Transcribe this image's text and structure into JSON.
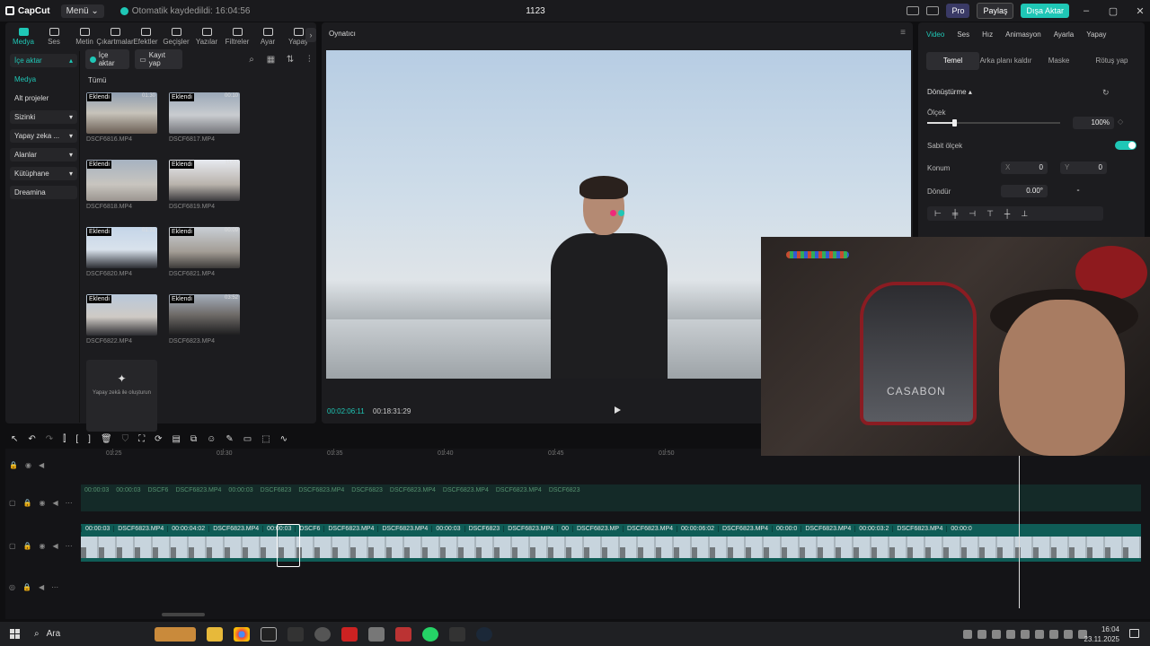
{
  "app": {
    "logo": "CapCut",
    "menu_label": "Menü",
    "autosave": "Otomatik kaydedildi: 16:04:56",
    "project_title": "1123",
    "pro_label": "Pro",
    "share_label": "Paylaş",
    "export_label": "Dışa Aktar"
  },
  "tabs": [
    {
      "label": "Medya"
    },
    {
      "label": "Ses"
    },
    {
      "label": "Metin"
    },
    {
      "label": "Çıkartmalar"
    },
    {
      "label": "Efektler"
    },
    {
      "label": "Geçişler"
    },
    {
      "label": "Yazılar"
    },
    {
      "label": "Filtreler"
    },
    {
      "label": "Ayar"
    },
    {
      "label": "Yapay"
    }
  ],
  "sidebar": [
    {
      "label": "İçe aktar"
    },
    {
      "label": "Medya"
    },
    {
      "label": "Alt projeler"
    },
    {
      "label": "Sizinki"
    },
    {
      "label": "Yapay zeka ..."
    },
    {
      "label": "Alanlar"
    },
    {
      "label": "Kütüphane"
    },
    {
      "label": "Dreamina"
    }
  ],
  "media": {
    "import_label": "İçe aktar",
    "record_label": "Kayıt yap",
    "all_label": "Tümü",
    "badge": "Eklendi",
    "files": [
      {
        "name": "DSCF6816.MP4",
        "duration": "01:30"
      },
      {
        "name": "DSCF6817.MP4",
        "duration": "00:10"
      },
      {
        "name": "DSCF6818.MP4",
        "duration": ""
      },
      {
        "name": "DSCF6819.MP4",
        "duration": "11:01"
      },
      {
        "name": "DSCF6820.MP4",
        "duration": "01:31"
      },
      {
        "name": "DSCF6821.MP4",
        "duration": "00:09"
      },
      {
        "name": "DSCF6822.MP4",
        "duration": ""
      },
      {
        "name": "DSCF6823.MP4",
        "duration": "03:52"
      }
    ],
    "ai_card": "Yapay zekâ ile oluşturun"
  },
  "player": {
    "title": "Oynatıcı",
    "current_time": "00:02:06:11",
    "total_time": "00:18:31:29"
  },
  "props": {
    "tabs": [
      "Video",
      "Ses",
      "Hız",
      "Animasyon",
      "Ayarla",
      "Yapay"
    ],
    "sub_tabs": [
      "Temel",
      "Arka planı kaldır",
      "Maske",
      "Rötuş yap"
    ],
    "section": "Dönüştürme",
    "scale_label": "Ölçek",
    "scale_value": "100%",
    "scale_level": 0.2,
    "uniform_label": "Sabit ölçek",
    "position_label": "Konum",
    "pos_x_label": "X",
    "pos_x": "0",
    "pos_y_label": "Y",
    "pos_y": "0",
    "rotate_label": "Döndür",
    "rotate_value": "0.00°"
  },
  "timeline": {
    "ruler": [
      "01:25",
      "01:30",
      "01:35",
      "01:40",
      "01:45",
      "01:50"
    ],
    "main_clips": [
      "00:00:03",
      "DSCF6823.MP4",
      "00:00:04:02",
      "DSCF6823.MP4",
      "00:00:03",
      "DSCF6",
      "DSCF6823.MP4",
      "DSCF6823.MP4",
      "00:00:03",
      "DSCF6823",
      "DSCF6823.MP4",
      "00",
      "DSCF6823.MP",
      "DSCF6823.MP4",
      "00:00:06:02",
      "DSCF6823.MP4",
      "00:00:0",
      "DSCF6823.MP4",
      "00:00:03:2",
      "DSCF6823.MP4",
      "00:00:0"
    ],
    "top_clips": [
      "00:00:03",
      "00:00:03",
      "DSCF6",
      "DSCF6823.MP4",
      "00:00:03",
      "DSCF6823",
      "DSCF6823.MP4",
      "DSCF6823",
      "DSCF6823.MP4",
      "DSCF6823.MP4",
      "DSCF6823.MP4",
      "DSCF6823"
    ]
  },
  "taskbar": {
    "search_label": "Ara",
    "time": "16:04",
    "date": "23.11.2025"
  },
  "webcam": {
    "chair_text": "CASABON"
  }
}
